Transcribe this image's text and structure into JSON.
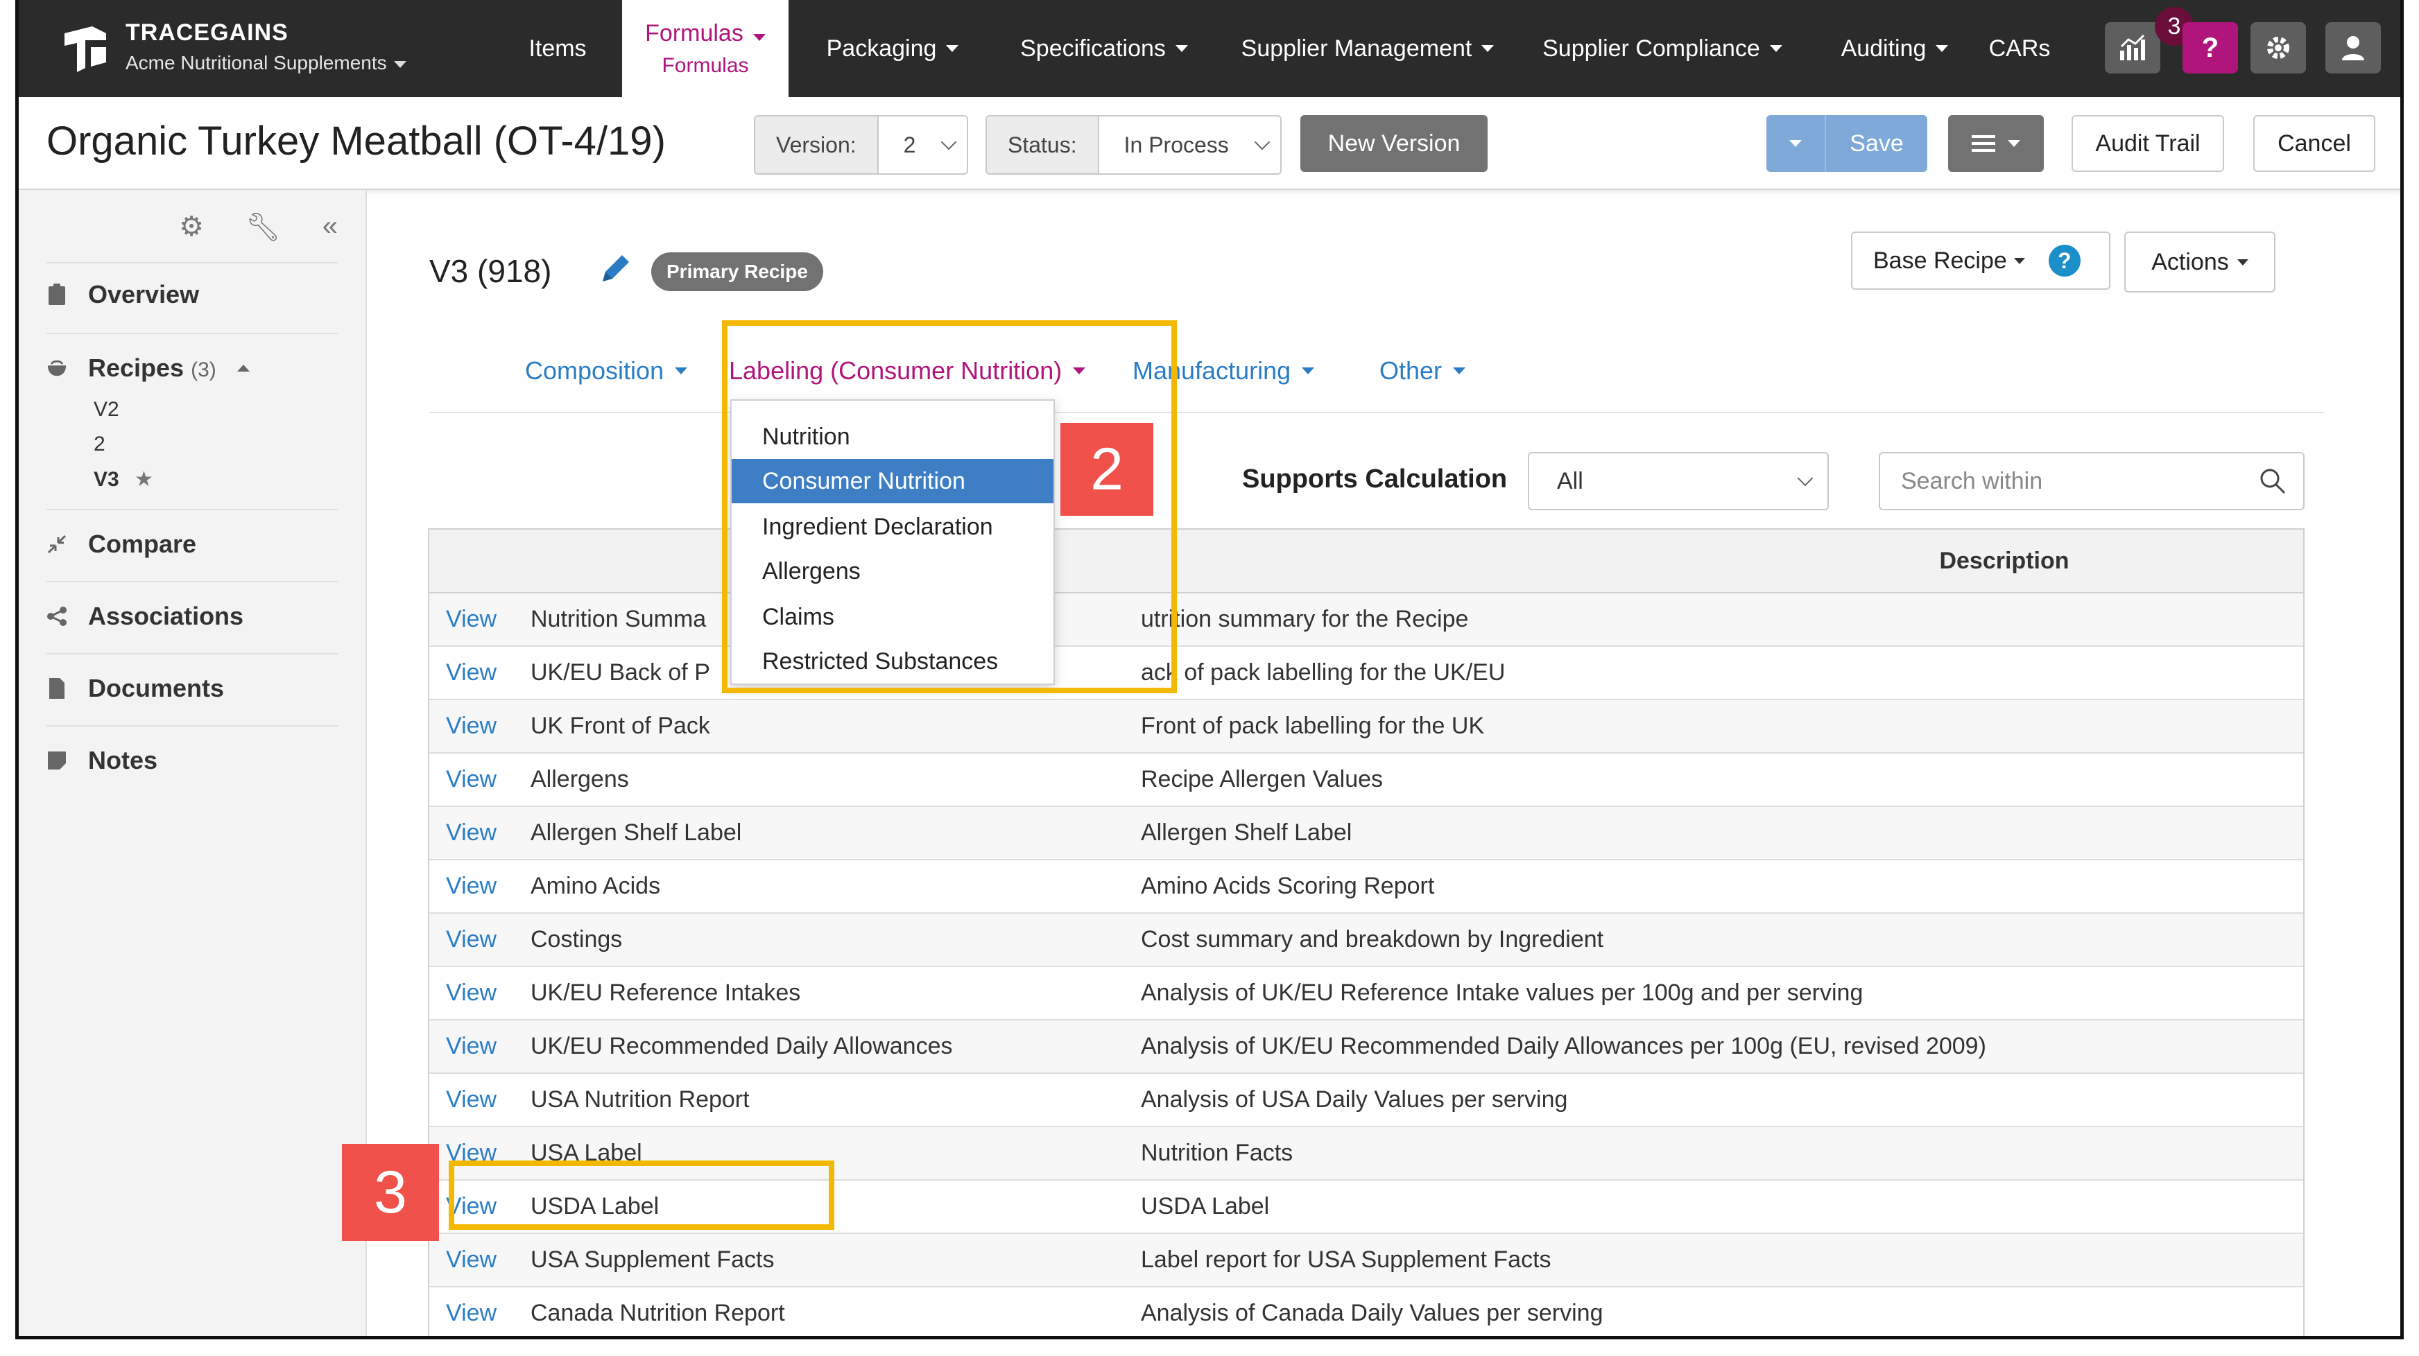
{
  "brand": {
    "name": "TRACEGAINS",
    "org": "Acme Nutritional Supplements"
  },
  "nav": {
    "items": [
      "Items",
      "Packaging",
      "Specifications",
      "Supplier Management",
      "Supplier Compliance",
      "Auditing",
      "CARs"
    ],
    "active": "Formulas",
    "active_sub": "Formulas",
    "notification_count": "3",
    "help_label": "?"
  },
  "header": {
    "title": "Organic Turkey Meatball (OT-4/19)",
    "version_label": "Version:",
    "version_value": "2",
    "status_label": "Status:",
    "status_value": "In Process",
    "new_version": "New Version",
    "save": "Save",
    "audit_trail": "Audit Trail",
    "cancel": "Cancel"
  },
  "sidebar": {
    "overview": "Overview",
    "recipes": "Recipes",
    "recipes_count": "(3)",
    "recipe_versions": [
      "V2",
      "2",
      "V3"
    ],
    "compare": "Compare",
    "associations": "Associations",
    "documents": "Documents",
    "notes": "Notes"
  },
  "content": {
    "version_title": "V3 (918)",
    "badge": "Primary Recipe",
    "base_recipe": "Base Recipe",
    "help": "?",
    "actions": "Actions",
    "tabs": [
      "Composition",
      "Labeling (Consumer Nutrition)",
      "Manufacturing",
      "Other"
    ],
    "dropdown": [
      "Nutrition",
      "Consumer Nutrition",
      "Ingredient Declaration",
      "Allergens",
      "Claims",
      "Restricted Substances"
    ],
    "supports_label": "Supports Calculation",
    "filter_value": "All",
    "search_placeholder": "Search within",
    "table_header_description": "Description",
    "view_label": "View",
    "rows": [
      {
        "name": "Nutrition Summa",
        "desc": "utrition summary for the Recipe"
      },
      {
        "name": "UK/EU Back of P",
        "desc": "ack of pack labelling for the UK/EU"
      },
      {
        "name": "UK Front of Pack",
        "desc": "Front of pack labelling for the UK"
      },
      {
        "name": "Allergens",
        "desc": "Recipe Allergen Values"
      },
      {
        "name": "Allergen Shelf Label",
        "desc": "Allergen Shelf Label"
      },
      {
        "name": "Amino Acids",
        "desc": "Amino Acids Scoring Report"
      },
      {
        "name": "Costings",
        "desc": "Cost summary and breakdown by Ingredient"
      },
      {
        "name": "UK/EU Reference Intakes",
        "desc": "Analysis of UK/EU Reference Intake values per 100g and per serving"
      },
      {
        "name": "UK/EU Recommended Daily Allowances",
        "desc": "Analysis of UK/EU Recommended Daily Allowances per 100g (EU, revised 2009)"
      },
      {
        "name": "USA Nutrition Report",
        "desc": "Analysis of USA Daily Values per serving"
      },
      {
        "name": "USA Label",
        "desc": "Nutrition Facts"
      },
      {
        "name": "USDA Label",
        "desc": "USDA Label"
      },
      {
        "name": "USA Supplement Facts",
        "desc": "Label report for USA Supplement Facts"
      },
      {
        "name": "Canada Nutrition Report",
        "desc": "Analysis of Canada Daily Values per serving"
      }
    ]
  },
  "callouts": {
    "step2": "2",
    "step3": "3"
  },
  "colors": {
    "nav_bg": "#2b2b2b",
    "accent_magenta": "#b0157c",
    "link_blue": "#2a7dc4",
    "highlight_yellow": "#f5b800",
    "callout_red": "#f0514a"
  }
}
